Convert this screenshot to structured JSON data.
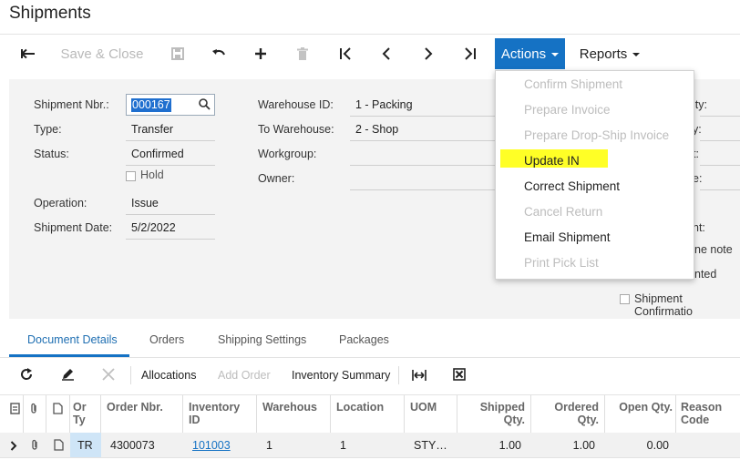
{
  "page": {
    "title": "Shipments"
  },
  "toolbar": {
    "save_close": "Save & Close",
    "actions": "Actions",
    "reports": "Reports"
  },
  "actions_menu": {
    "items": [
      {
        "label": "Confirm Shipment",
        "enabled": false
      },
      {
        "label": "Prepare Invoice",
        "enabled": false
      },
      {
        "label": "Prepare Drop-Ship Invoice",
        "enabled": false
      },
      {
        "label": "Update IN",
        "enabled": true
      },
      {
        "label": "Correct Shipment",
        "enabled": true
      },
      {
        "label": "Cancel Return",
        "enabled": false
      },
      {
        "label": "Email Shipment",
        "enabled": true
      },
      {
        "label": "Print Pick List",
        "enabled": false
      }
    ],
    "highlight_color": "#ffff26"
  },
  "form": {
    "shipment_nbr": {
      "label": "Shipment Nbr.:",
      "value": "000167"
    },
    "type": {
      "label": "Type:",
      "value": "Transfer"
    },
    "status": {
      "label": "Status:",
      "value": "Confirmed"
    },
    "hold": {
      "label": "Hold",
      "checked": false
    },
    "operation": {
      "label": "Operation:",
      "value": "Issue"
    },
    "shipment_date": {
      "label": "Shipment Date:",
      "value": "5/2/2022"
    },
    "warehouse_id": {
      "label": "Warehouse ID:",
      "value": "1 - Packing"
    },
    "to_warehouse": {
      "label": "To Warehouse:",
      "value": "2 - Shop"
    },
    "workgroup": {
      "label": "Workgroup:",
      "value": ""
    },
    "owner": {
      "label": "Owner:",
      "value": ""
    },
    "right_fragments": [
      "ity:",
      "y:",
      "t:",
      "e:",
      "nt:",
      "ne note",
      "nted"
    ],
    "shipment_confirmation": {
      "label": "Shipment Confirmatio",
      "checked": false
    }
  },
  "tabs": [
    "Document Details",
    "Orders",
    "Shipping Settings",
    "Packages"
  ],
  "grid_toolbar": {
    "allocations": "Allocations",
    "add_order": "Add Order",
    "inventory_summary": "Inventory Summary"
  },
  "grid": {
    "columns": [
      "Or Ty",
      "Order Nbr.",
      "Inventory ID",
      "Warehous",
      "Location",
      "UOM",
      "Shipped Qty.",
      "Ordered Qty.",
      "Open Qty.",
      "Reason Code"
    ],
    "rows": [
      {
        "order_type": "TR",
        "order_nbr": "4300073",
        "inventory_id": "101003",
        "warehouse": "1",
        "location": "1",
        "uom": "STY…",
        "shipped_qty": "1.00",
        "ordered_qty": "1.00",
        "open_qty": "0.00",
        "reason_code": ""
      }
    ]
  },
  "colors": {
    "accent": "#1572c4",
    "form_bg": "#f3f3f3",
    "selection": "#1f6fcf"
  }
}
